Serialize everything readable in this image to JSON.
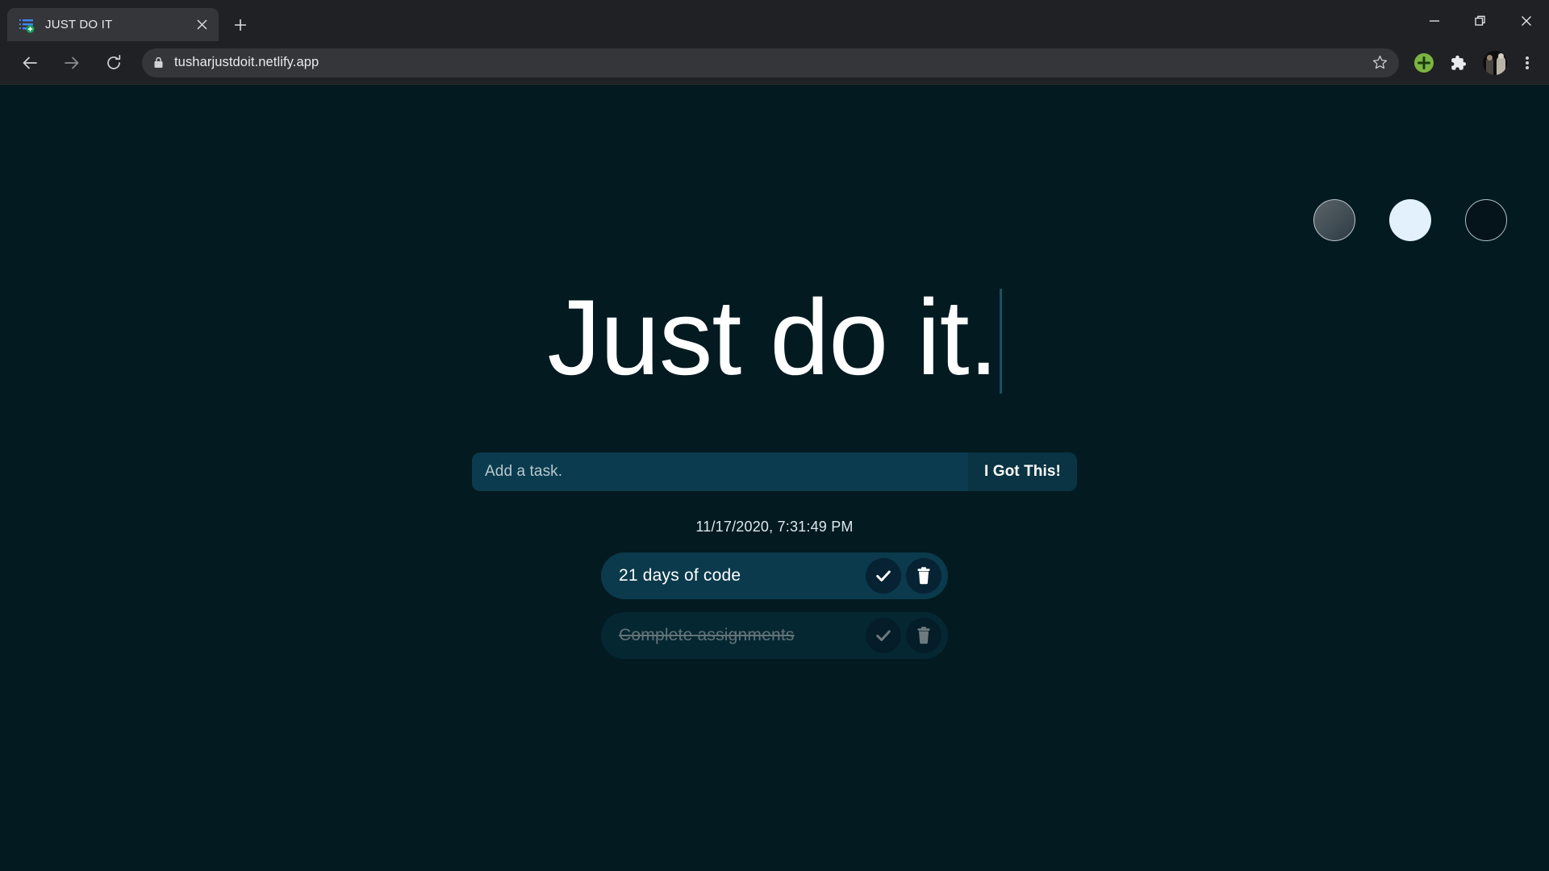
{
  "browser": {
    "tab": {
      "title": "JUST DO IT",
      "favicon_icon": "list-plus-icon",
      "close_icon": "close-icon"
    },
    "new_tab_icon": "plus-icon",
    "window_controls": {
      "minimize_icon": "minimize-icon",
      "maximize_icon": "restore-icon",
      "close_icon": "close-icon"
    },
    "toolbar": {
      "back_icon": "back-arrow-icon",
      "forward_icon": "forward-arrow-icon",
      "reload_icon": "reload-icon",
      "lock_icon": "lock-icon",
      "url": "tusharjustdoit.netlify.app",
      "bookmark_icon": "star-icon",
      "add_extension_icon": "green-plus-icon",
      "extensions_icon": "puzzle-piece-icon",
      "profile_icon": "avatar-photo",
      "menu_icon": "three-dots-icon"
    }
  },
  "page": {
    "background_color": "#031a20",
    "themes": {
      "label": "theme-switcher",
      "options": [
        {
          "name": "gray-theme",
          "color": "#4b565d"
        },
        {
          "name": "light-theme",
          "color": "#e2f1fb"
        },
        {
          "name": "dark-theme",
          "color": "#05141b"
        }
      ]
    },
    "title": "Just do it.",
    "caret_color": "#1d4f63",
    "form": {
      "placeholder": "Add a task.",
      "value": "",
      "submit_label": "I Got This!",
      "input_bg": "#0a3b4e",
      "button_bg": "#0a3343"
    },
    "timestamp": "11/17/2020, 7:31:49 PM",
    "tasks": [
      {
        "text": "21 days of code",
        "completed": false,
        "complete_icon": "check-icon",
        "delete_icon": "trash-icon"
      },
      {
        "text": "Complete assignments",
        "completed": true,
        "complete_icon": "check-icon",
        "delete_icon": "trash-icon"
      }
    ]
  }
}
